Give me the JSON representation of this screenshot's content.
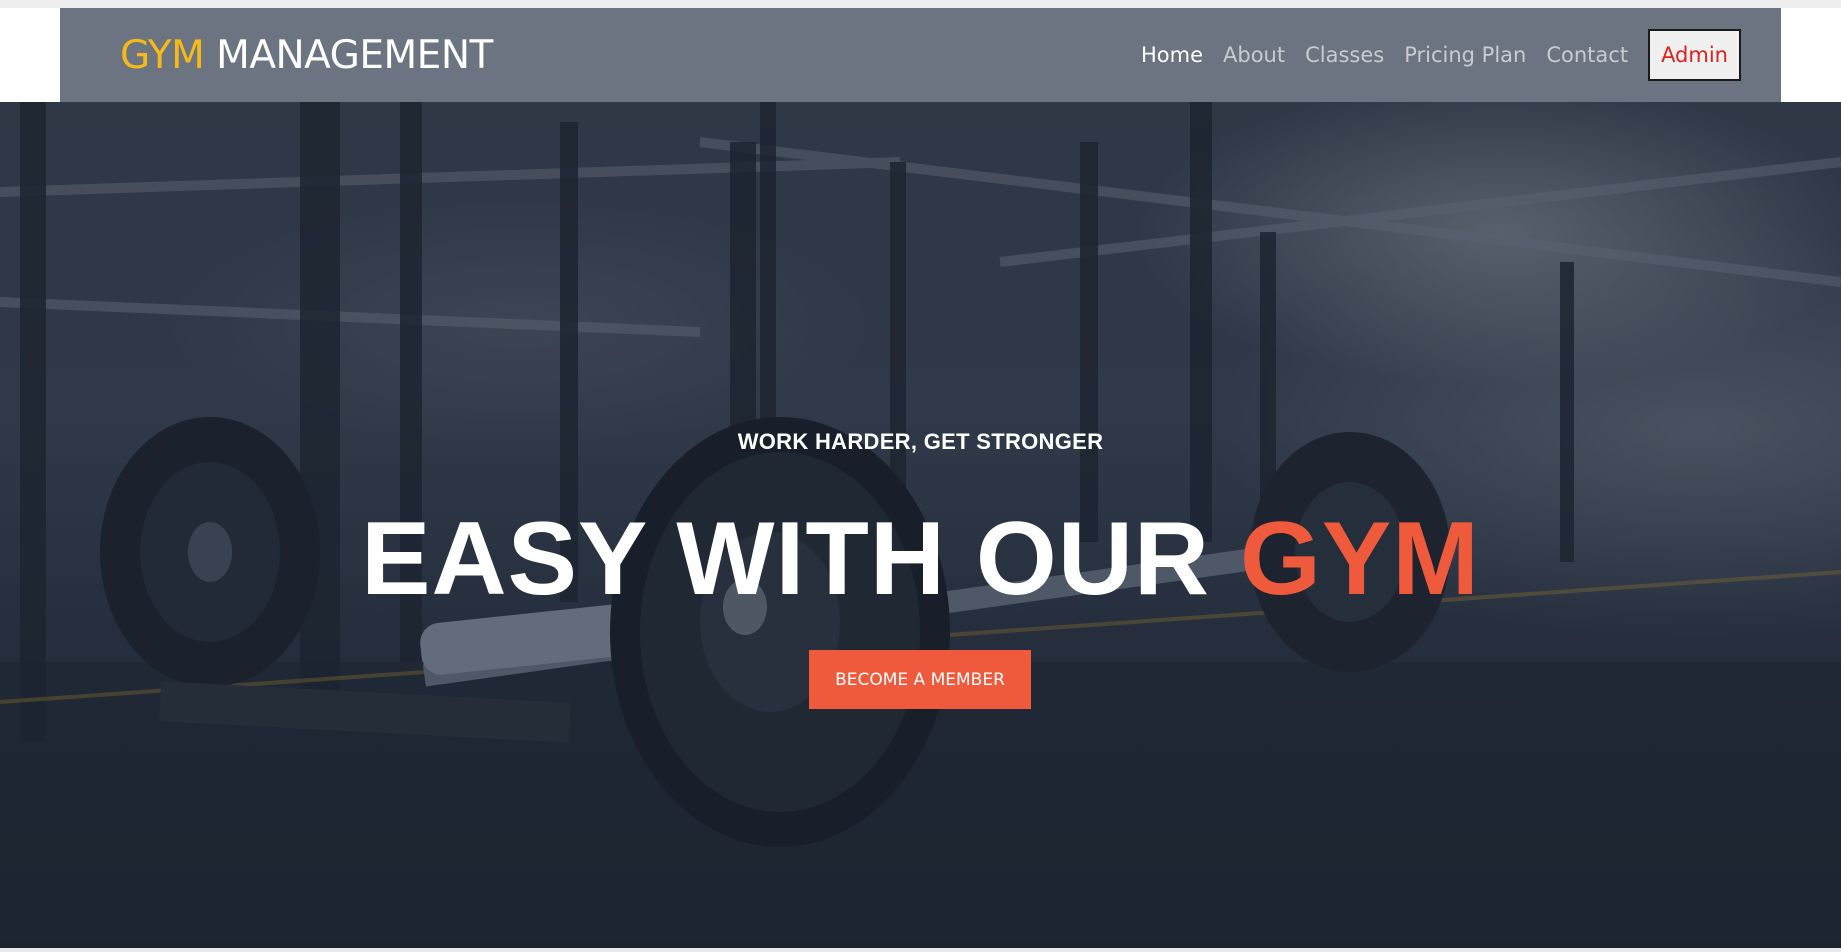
{
  "brand": {
    "accent": "GYM",
    "rest": "MANAGEMENT"
  },
  "nav": {
    "items": [
      {
        "label": "Home",
        "active": true
      },
      {
        "label": "About",
        "active": false
      },
      {
        "label": "Classes",
        "active": false
      },
      {
        "label": "Pricing Plan",
        "active": false
      },
      {
        "label": "Contact",
        "active": false
      }
    ],
    "admin_label": "Admin"
  },
  "hero": {
    "subtitle": "WORK HARDER, GET STRONGER",
    "headline_main": "EASY WITH OUR",
    "headline_accent": "GYM",
    "cta_label": "BECOME A MEMBER"
  },
  "colors": {
    "navbar": "#6b7480",
    "brand_accent": "#f6b91a",
    "highlight": "#f05a3c",
    "admin_text": "#e02020"
  }
}
